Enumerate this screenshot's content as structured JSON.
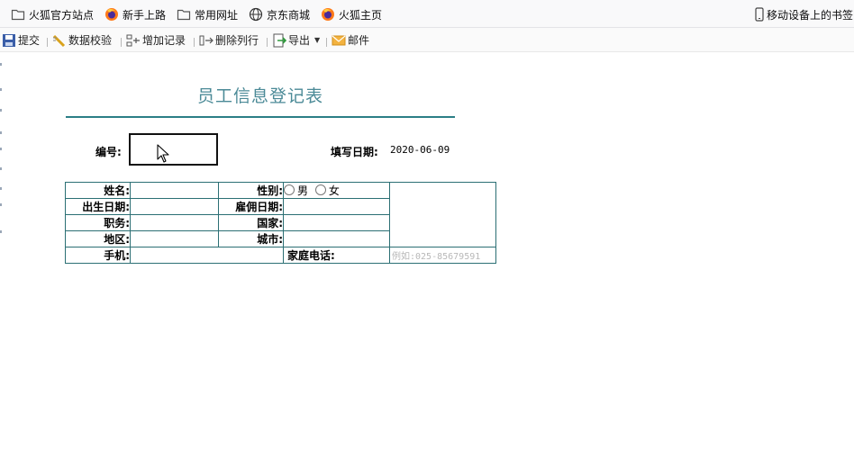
{
  "bookmarks": {
    "items": [
      {
        "label": "火狐官方站点",
        "icon": "folder-icon"
      },
      {
        "label": "新手上路",
        "icon": "firefox-icon"
      },
      {
        "label": "常用网址",
        "icon": "folder-icon"
      },
      {
        "label": "京东商城",
        "icon": "globe-icon"
      },
      {
        "label": "火狐主页",
        "icon": "firefox-icon"
      }
    ],
    "mobile_label": "移动设备上的书签"
  },
  "toolbar": {
    "submit": "提交",
    "validate": "数据校验",
    "add_record": "增加记录",
    "delete_row": "删除列行",
    "export": "导出",
    "mail": "邮件"
  },
  "form": {
    "title": "员工信息登记表",
    "number_label": "编号:",
    "number_value": "",
    "date_label": "填写日期:",
    "date_value": "2020-06-09",
    "fields": {
      "name": "姓名:",
      "gender": "性别:",
      "male": "男",
      "female": "女",
      "birth": "出生日期:",
      "hire": "雇佣日期:",
      "position": "职务:",
      "country": "国家:",
      "region": "地区:",
      "city": "城市:",
      "mobile": "手机:",
      "home_phone": "家庭电话:",
      "home_phone_placeholder": "例如:025-85679591"
    }
  }
}
